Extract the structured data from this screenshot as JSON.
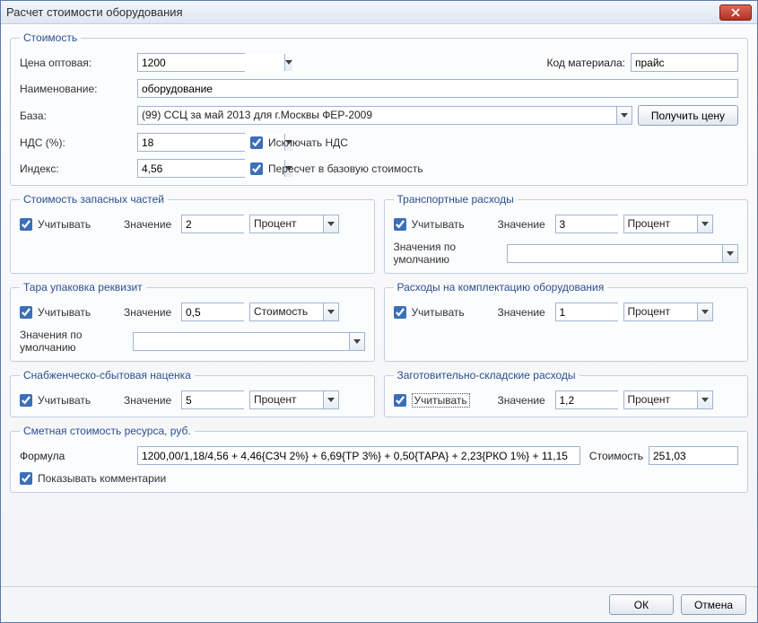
{
  "window": {
    "title": "Расчет стоимости оборудования"
  },
  "cost": {
    "legend": "Стоимость",
    "price_label": "Цена оптовая:",
    "price_value": "1200",
    "matcode_label": "Код материала:",
    "matcode_value": "прайс",
    "name_label": "Наименование:",
    "name_value": "оборудование",
    "base_label": "База:",
    "base_value": "(99) ССЦ за май 2013 для г.Москвы ФЕР-2009",
    "get_price_btn": "Получить цену",
    "vat_label": "НДС (%):",
    "vat_value": "18",
    "exclude_vat": "Исключать НДС",
    "index_label": "Индекс:",
    "index_value": "4,56",
    "recalc_base": "Пересчет в базовую стоимость"
  },
  "spare": {
    "legend": "Стоимость запасных частей",
    "consider": "Учитывать",
    "value_label": "Значение",
    "value": "2",
    "unit": "Процент"
  },
  "transport": {
    "legend": "Транспортные расходы",
    "consider": "Учитывать",
    "value_label": "Значение",
    "value": "3",
    "unit": "Процент",
    "defaults_label": "Значения по умолчанию",
    "defaults_value": ""
  },
  "tara": {
    "legend": "Тара упаковка реквизит",
    "consider": "Учитывать",
    "value_label": "Значение",
    "value": "0,5",
    "unit": "Стоимость",
    "defaults_label": "Значения по умолчанию",
    "defaults_value": ""
  },
  "complete": {
    "legend": "Расходы на комплектацию оборудования",
    "consider": "Учитывать",
    "value_label": "Значение",
    "value": "1",
    "unit": "Процент"
  },
  "markup": {
    "legend": "Снабженческо-сбытовая наценка",
    "consider": "Учитывать",
    "value_label": "Значение",
    "value": "5",
    "unit": "Процент"
  },
  "storage": {
    "legend": "Заготовительно-складские расходы",
    "consider": "Учитывать",
    "value_label": "Значение",
    "value": "1,2",
    "unit": "Процент"
  },
  "estimate": {
    "legend": "Сметная стоимость ресурса, руб.",
    "formula_label": "Формула",
    "formula_value": "1200,00/1,18/4,56 + 4,46{СЗЧ 2%} + 6,69{ТР 3%} + 0,50{ТАРА} + 2,23{РКО 1%} + 11,15",
    "cost_label": "Стоимость",
    "cost_value": "251,03",
    "show_comments": "Показывать комментарии"
  },
  "buttons": {
    "ok": "ОК",
    "cancel": "Отмена"
  }
}
